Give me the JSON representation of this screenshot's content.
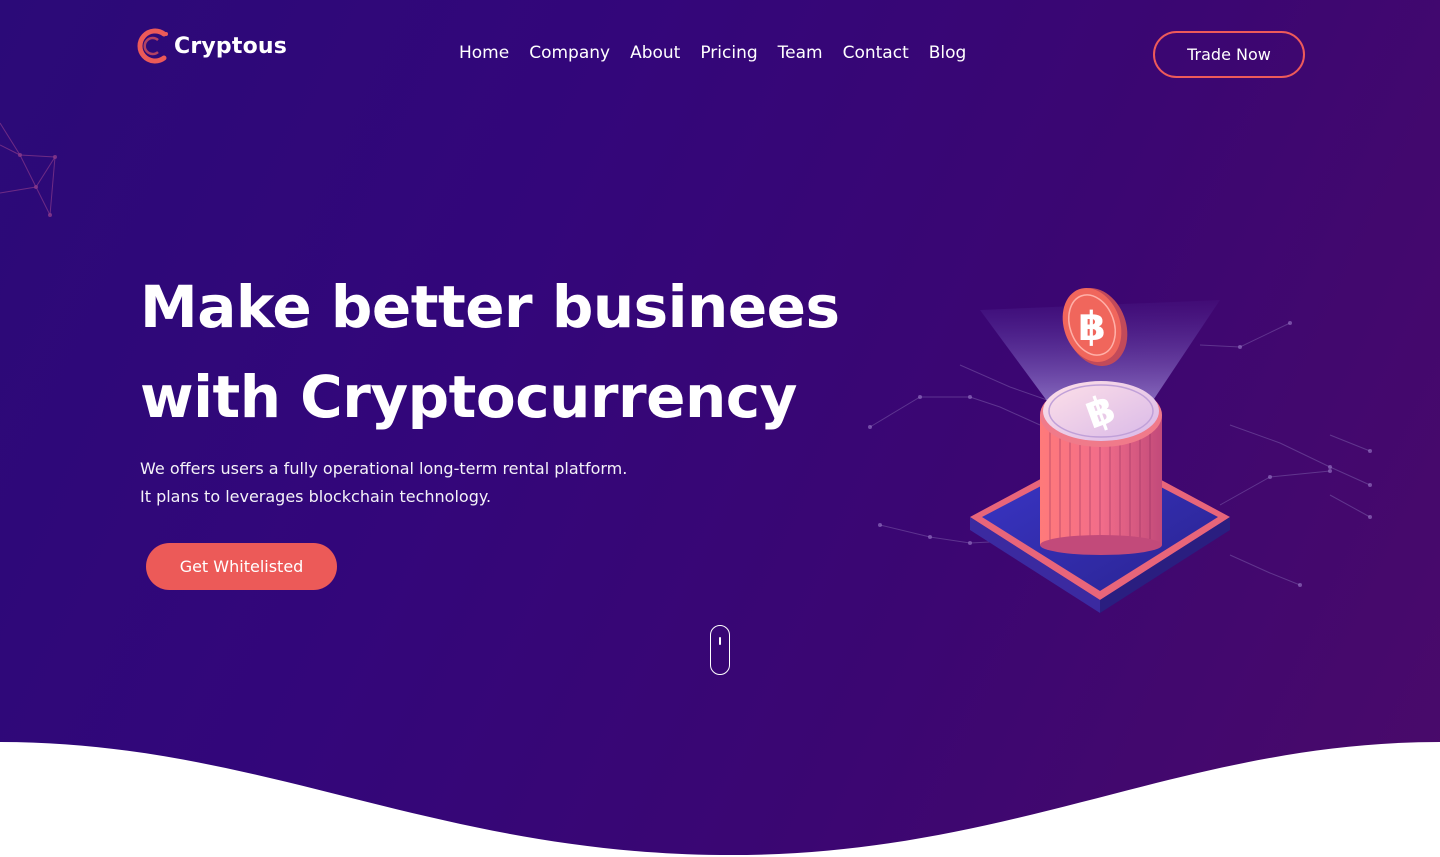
{
  "header": {
    "logo_text": "Cryptous",
    "nav": [
      {
        "label": "Home"
      },
      {
        "label": "Company"
      },
      {
        "label": "About"
      },
      {
        "label": "Pricing"
      },
      {
        "label": "Team"
      },
      {
        "label": "Contact"
      },
      {
        "label": "Blog"
      }
    ],
    "trade_label": "Trade Now"
  },
  "hero": {
    "title": "Make better businees with Cryptocurrency",
    "subtitle_line1": "We offers users a fully operational long-term rental platform.",
    "subtitle_line2": "It plans to leverages blockchain technology.",
    "cta_label": "Get Whitelisted"
  },
  "icons": {
    "logo": "c-logo-icon",
    "scroll": "scroll-mouse-icon",
    "coin": "bitcoin-coin-icon",
    "illustration": "coin-stack-illustration"
  },
  "colors": {
    "accent": "#ec5a58",
    "background_start": "#2b0a78",
    "background_end": "#4a0a6a",
    "text": "#ffffff"
  }
}
